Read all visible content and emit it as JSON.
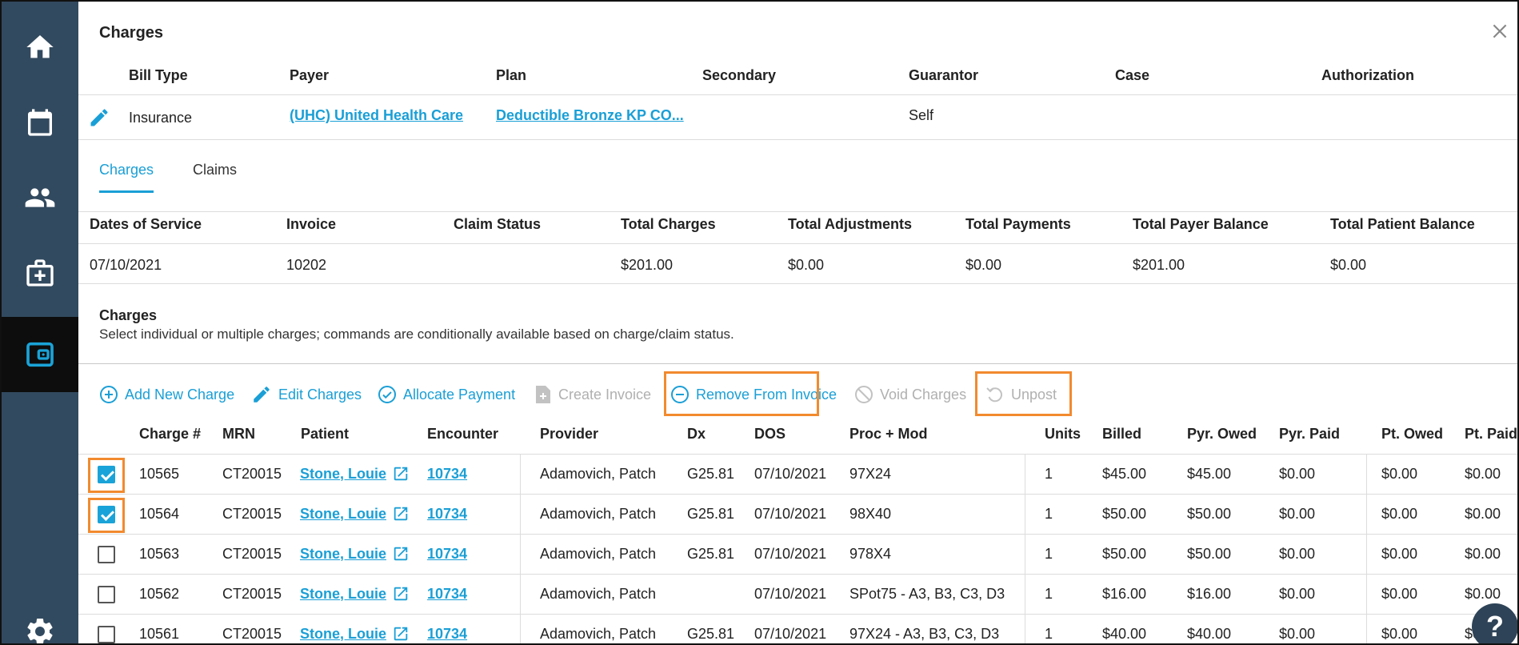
{
  "modal": {
    "title": "Charges",
    "close_icon": "close-icon"
  },
  "nav": {
    "items": [
      {
        "icon": "home-icon"
      },
      {
        "icon": "calendar-icon"
      },
      {
        "icon": "people-icon"
      },
      {
        "icon": "medical-kit-icon"
      },
      {
        "icon": "wallet-icon",
        "active": true
      },
      {
        "icon": "gear-icon"
      }
    ]
  },
  "bill": {
    "headers": {
      "bill_type": "Bill Type",
      "payer": "Payer",
      "plan": "Plan",
      "secondary": "Secondary",
      "guarantor": "Guarantor",
      "case": "Case",
      "authorization": "Authorization"
    },
    "values": {
      "bill_type": "Insurance",
      "payer": "(UHC) United Health Care",
      "plan": "Deductible Bronze KP CO...",
      "secondary": "",
      "guarantor": "Self",
      "case": "",
      "authorization": ""
    }
  },
  "tabs": [
    {
      "label": "Charges",
      "active": true
    },
    {
      "label": "Claims",
      "active": false
    }
  ],
  "summary": {
    "headers": [
      "Dates of Service",
      "Invoice",
      "Claim Status",
      "Total Charges",
      "Total Adjustments",
      "Total Payments",
      "Total Payer Balance",
      "Total Patient Balance"
    ],
    "values": [
      "07/10/2021",
      "10202",
      "",
      "$201.00",
      "$0.00",
      "$0.00",
      "$201.00",
      "$0.00"
    ]
  },
  "charges_section": {
    "title": "Charges",
    "description": "Select individual or multiple charges; commands are conditionally available based on charge/claim status."
  },
  "commands": {
    "add_new_charge": "Add New Charge",
    "edit_charges": "Edit Charges",
    "allocate_payment": "Allocate Payment",
    "create_invoice": "Create Invoice",
    "remove_from_invoice": "Remove From Invoice",
    "void_charges": "Void Charges",
    "unpost": "Unpost"
  },
  "table": {
    "headers": [
      "Charge #",
      "MRN",
      "Patient",
      "Encounter",
      "Provider",
      "Dx",
      "DOS",
      "Proc + Mod",
      "Units",
      "Billed",
      "Pyr. Owed",
      "Pyr. Paid",
      "Pt. Owed",
      "Pt. Paid"
    ],
    "rows": [
      {
        "checked": true,
        "charge": "10565",
        "mrn": "CT20015",
        "patient": "Stone, Louie",
        "encounter": "10734",
        "provider": "Adamovich, Patch",
        "dx": "G25.81",
        "dos": "07/10/2021",
        "proc": "97X24",
        "units": "1",
        "billed": "$45.00",
        "pyr_owed": "$45.00",
        "pyr_paid": "$0.00",
        "pt_owed": "$0.00",
        "pt_paid": "$0.00"
      },
      {
        "checked": true,
        "charge": "10564",
        "mrn": "CT20015",
        "patient": "Stone, Louie",
        "encounter": "10734",
        "provider": "Adamovich, Patch",
        "dx": "G25.81",
        "dos": "07/10/2021",
        "proc": "98X40",
        "units": "1",
        "billed": "$50.00",
        "pyr_owed": "$50.00",
        "pyr_paid": "$0.00",
        "pt_owed": "$0.00",
        "pt_paid": "$0.00"
      },
      {
        "checked": false,
        "charge": "10563",
        "mrn": "CT20015",
        "patient": "Stone, Louie",
        "encounter": "10734",
        "provider": "Adamovich, Patch",
        "dx": "G25.81",
        "dos": "07/10/2021",
        "proc": "978X4",
        "units": "1",
        "billed": "$50.00",
        "pyr_owed": "$50.00",
        "pyr_paid": "$0.00",
        "pt_owed": "$0.00",
        "pt_paid": "$0.00"
      },
      {
        "checked": false,
        "charge": "10562",
        "mrn": "CT20015",
        "patient": "Stone, Louie",
        "encounter": "10734",
        "provider": "Adamovich, Patch",
        "dx": "",
        "dos": "07/10/2021",
        "proc": "SPot75 - A3, B3, C3, D3",
        "units": "1",
        "billed": "$16.00",
        "pyr_owed": "$16.00",
        "pyr_paid": "$0.00",
        "pt_owed": "$0.00",
        "pt_paid": "$0.00"
      },
      {
        "checked": false,
        "charge": "10561",
        "mrn": "CT20015",
        "patient": "Stone, Louie",
        "encounter": "10734",
        "provider": "Adamovich, Patch",
        "dx": "G25.81",
        "dos": "07/10/2021",
        "proc": "97X24 - A3, B3, C3, D3",
        "units": "1",
        "billed": "$40.00",
        "pyr_owed": "$40.00",
        "pyr_paid": "$0.00",
        "pt_owed": "$0.00",
        "pt_paid": "$0.00"
      }
    ]
  },
  "colors": {
    "nav_bg": "#324a5f",
    "accent": "#1a9fd6",
    "highlight": "#f28a2e",
    "disabled": "#b0b0b0"
  },
  "help": {
    "label": "?"
  }
}
